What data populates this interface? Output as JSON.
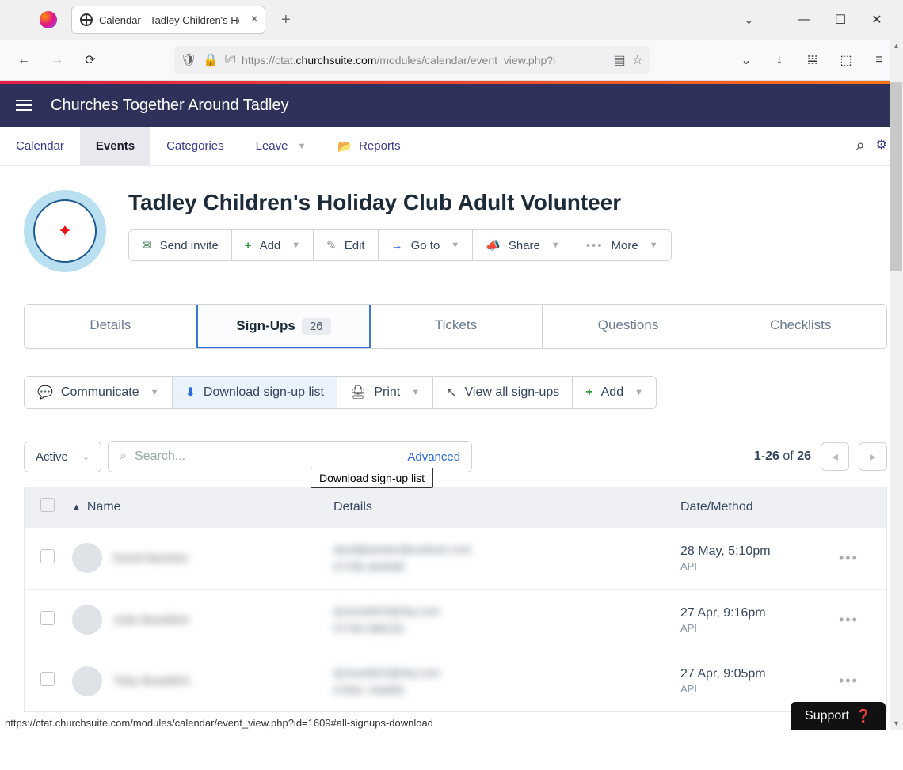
{
  "browser": {
    "tab_title": "Calendar - Tadley Children's Ho",
    "url_prefix": "https://ctat.",
    "url_domain": "churchsuite.com",
    "url_suffix": "/modules/calendar/event_view.php?i"
  },
  "app": {
    "title": "Churches Together Around Tadley"
  },
  "nav": {
    "calendar": "Calendar",
    "events": "Events",
    "categories": "Categories",
    "leave": "Leave",
    "reports": "Reports"
  },
  "event": {
    "title": "Tadley Children's Holiday Club Adult Volunteer",
    "actions": {
      "send_invite": "Send invite",
      "add": "Add",
      "edit": "Edit",
      "goto": "Go to",
      "share": "Share",
      "more": "More"
    }
  },
  "tabs": {
    "details": "Details",
    "signups": "Sign-Ups",
    "signups_count": "26",
    "tickets": "Tickets",
    "questions": "Questions",
    "checklists": "Checklists"
  },
  "table_toolbar": {
    "communicate": "Communicate",
    "download": "Download sign-up list",
    "print": "Print",
    "viewall": "View all sign-ups",
    "add": "Add"
  },
  "tooltip_text": "Download sign-up list",
  "filter": {
    "active": "Active",
    "search_placeholder": "Search...",
    "advanced": "Advanced"
  },
  "pagination": {
    "range_start": "1",
    "range_end": "26",
    "of": "of",
    "total": "26"
  },
  "columns": {
    "name": "Name",
    "details": "Details",
    "date": "Date/Method"
  },
  "rows": [
    {
      "name": "David Bamber",
      "line1": "davidjbamber@outlook.com",
      "line2": "07786 464566",
      "date": "28 May, 5:10pm",
      "method": "API"
    },
    {
      "name": "Julie Bowditch",
      "line1": "dj.bowditch@sky.com",
      "line2": "07780 586192",
      "date": "27 Apr, 9:16pm",
      "method": "API"
    },
    {
      "name": "Toby Bowditch",
      "line1": "dj.bowditch@sky.com",
      "line2": "07891 764855",
      "date": "27 Apr, 9:05pm",
      "method": "API"
    }
  ],
  "status_url": "https://ctat.churchsuite.com/modules/calendar/event_view.php?id=1609#all-signups-download",
  "support_label": "Support"
}
